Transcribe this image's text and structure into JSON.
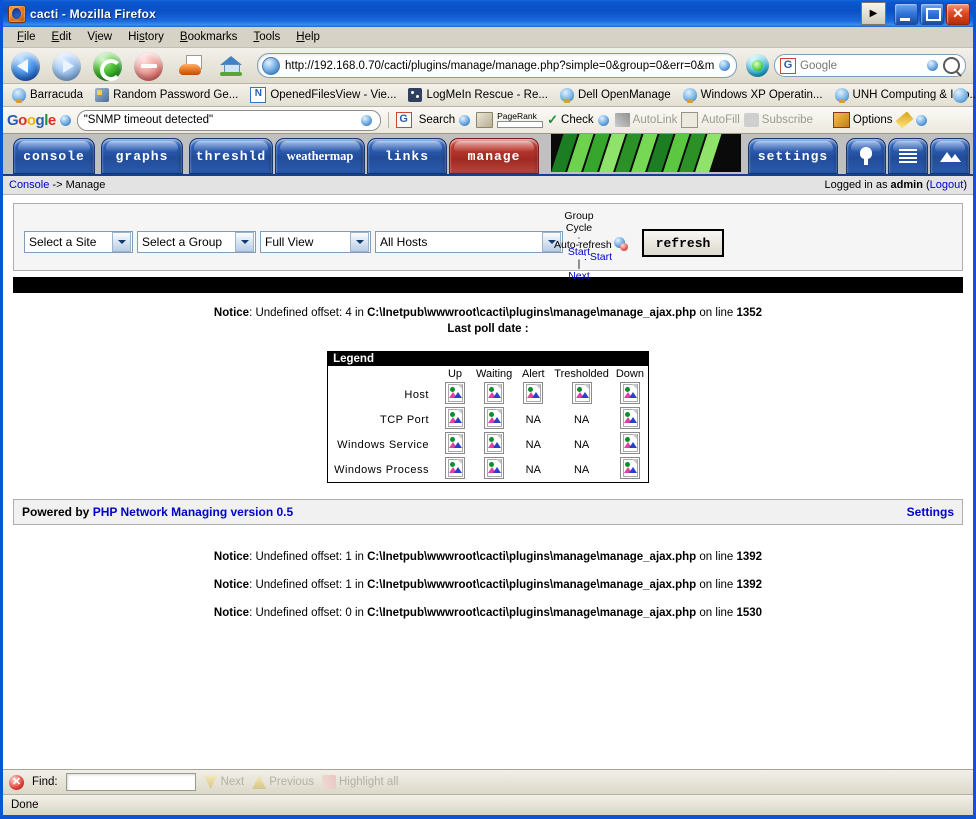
{
  "window": {
    "title": "cacti - Mozilla Firefox",
    "app_icon": "firefox-icon",
    "buttons": {
      "extra": "▶",
      "minimize": "_",
      "maximize": "□",
      "close": "✕"
    }
  },
  "menubar": {
    "items": [
      "File",
      "Edit",
      "View",
      "History",
      "Bookmarks",
      "Tools",
      "Help"
    ]
  },
  "toolbar": {
    "back": "back-button",
    "forward": "forward-button",
    "reload": "reload-button",
    "stop": "stop-button",
    "print": "print-button",
    "home": "home-button",
    "url": "http://192.168.0.70/cacti/plugins/manage/manage.php?simple=0&group=0&err=0&m",
    "search_placeholder": "Google"
  },
  "bookmarks": {
    "items": [
      {
        "label": "Barracuda",
        "icon": "bookmark-icon"
      },
      {
        "label": "Random Password Ge...",
        "icon": "key-icon"
      },
      {
        "label": "OpenedFilesView - Vie...",
        "icon": "nirsoft-icon"
      },
      {
        "label": "LogMeIn Rescue - Re...",
        "icon": "logmein-icon"
      },
      {
        "label": "Dell OpenManage",
        "icon": "bookmark-icon"
      },
      {
        "label": "Windows XP Operatin...",
        "icon": "bookmark-icon"
      },
      {
        "label": "UNH Computing & Info...",
        "icon": "bookmark-icon"
      }
    ]
  },
  "google_toolbar": {
    "logo": {
      "g1": "G",
      "o1": "o",
      "o2": "o",
      "g2": "g",
      "l": "l",
      "e": "e"
    },
    "query": "\"SNMP timeout detected\"",
    "search_label": "Search",
    "pagerank_label": "PageRank",
    "check_label": "Check",
    "autolink_label": "AutoLink",
    "autofill_label": "AutoFill",
    "subscribe_label": "Subscribe",
    "options_label": "Options"
  },
  "cacti": {
    "tabs": [
      {
        "label": "console",
        "active": false
      },
      {
        "label": "graphs",
        "active": false
      },
      {
        "label": "threshld",
        "active": false
      },
      {
        "label": "weathermap",
        "active": false
      },
      {
        "label": "links",
        "active": false
      },
      {
        "label": "manage",
        "active": true
      }
    ],
    "right_tabs": [
      {
        "label": "settings",
        "icon": ""
      },
      {
        "label": "",
        "icon": "tree-icon"
      },
      {
        "label": "",
        "icon": "list-icon"
      },
      {
        "label": "",
        "icon": "graph-icon"
      }
    ],
    "breadcrumb": {
      "console_link": "Console",
      "separator": " -> ",
      "current": "Manage"
    },
    "session": {
      "prefix": "Logged in as ",
      "user": "admin",
      "logout_open": " (",
      "logout": "Logout",
      "logout_close": ")"
    }
  },
  "filters": {
    "site": "Select a Site",
    "group": "Select a Group",
    "view": "Full View",
    "hosts": "All Hosts",
    "group_cycle": {
      "label_line1": "Group",
      "label_line2": "Cycle",
      "label_line3": ":",
      "start": "Start",
      "divider": "|",
      "next": "Next"
    },
    "auto_refresh": {
      "label": "Auto-refresh",
      "colon": ":",
      "start": "Start"
    },
    "refresh_button": "refresh"
  },
  "notices": {
    "top": {
      "prefix": "Notice",
      "colon": ": ",
      "message": "Undefined offset: 4 in ",
      "path": "C:\\Inetpub\\wwwroot\\cacti\\plugins\\manage\\manage_ajax.php",
      "on_line": " on line ",
      "line": "1352",
      "sub": "Last poll date :"
    },
    "bottom": [
      {
        "prefix": "Notice",
        "colon": ": ",
        "message": "Undefined offset: 1 in ",
        "path": "C:\\Inetpub\\wwwroot\\cacti\\plugins\\manage\\manage_ajax.php",
        "on_line": " on line ",
        "line": "1392"
      },
      {
        "prefix": "Notice",
        "colon": ": ",
        "message": "Undefined offset: 1 in ",
        "path": "C:\\Inetpub\\wwwroot\\cacti\\plugins\\manage\\manage_ajax.php",
        "on_line": " on line ",
        "line": "1392"
      },
      {
        "prefix": "Notice",
        "colon": ": ",
        "message": "Undefined offset: 0 in ",
        "path": "C:\\Inetpub\\wwwroot\\cacti\\plugins\\manage\\manage_ajax.php",
        "on_line": " on line ",
        "line": "1530"
      }
    ]
  },
  "legend": {
    "title": "Legend",
    "columns": [
      "Up",
      "Waiting",
      "Alert",
      "Tresholded",
      "Down"
    ],
    "rows": [
      {
        "label": "Host",
        "cells": [
          "image",
          "image",
          "image",
          "image",
          "image"
        ]
      },
      {
        "label": "TCP Port",
        "cells": [
          "image",
          "image",
          "NA",
          "NA",
          "image"
        ]
      },
      {
        "label": "Windows Service",
        "cells": [
          "image",
          "image",
          "NA",
          "NA",
          "image"
        ]
      },
      {
        "label": "Windows Process",
        "cells": [
          "image",
          "image",
          "NA",
          "NA",
          "image"
        ]
      }
    ]
  },
  "powered": {
    "prefix": "Powered by ",
    "product": "PHP Network Managing version 0.5",
    "settings": "Settings"
  },
  "findbar": {
    "close": "✕",
    "label": "Find:",
    "value": "",
    "next": "Next",
    "previous": "Previous",
    "highlight": "Highlight all"
  },
  "statusbar": {
    "text": "Done"
  },
  "colors": {
    "titlebar_blue": "#0b57cf",
    "tab_blue": "#2f62ba",
    "tab_active_red": "#bf3a31",
    "link_blue": "#0000cc",
    "black_bar": "#000000"
  }
}
